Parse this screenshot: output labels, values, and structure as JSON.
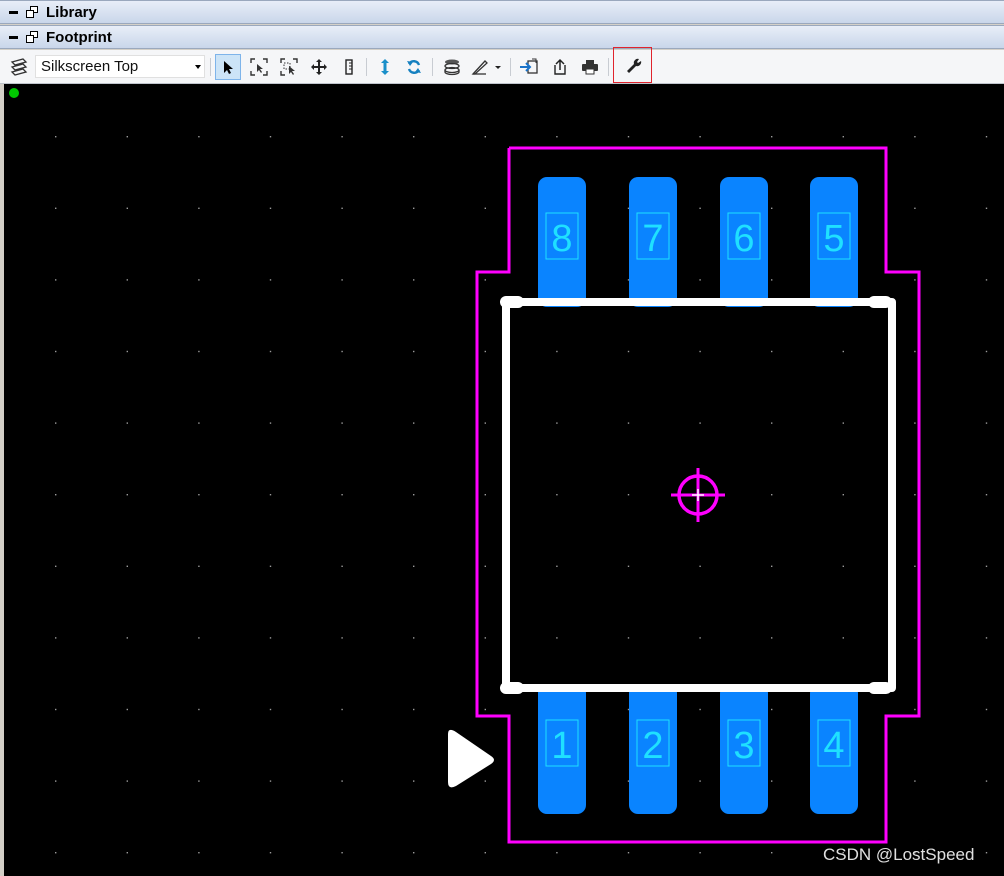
{
  "panels": {
    "library_title": "Library",
    "footprint_title": "Footprint"
  },
  "toolbar": {
    "layer_value": "Silkscreen Top",
    "icons": [
      "layers-icon",
      "select-arrow-icon",
      "zoom-fit-icon",
      "zoom-area-icon",
      "move-icon",
      "measure-icon",
      "flip-icon",
      "rotate-icon",
      "layer-stack-icon",
      "draw-tool-icon",
      "import-icon",
      "export-icon",
      "print-icon",
      "wrench-icon"
    ]
  },
  "canvas": {
    "background": "#000000",
    "grid_dot_color": "#9a9a9a",
    "courtyard_color": "#ff00ff",
    "pad_color": "#0a84ff",
    "pad_number_color": "#1fe0ff",
    "silkscreen_color": "#ffffff",
    "assembly_color": "#ffcc00",
    "origin_dot_color": "#00c800",
    "top_pads": [
      "8",
      "7",
      "6",
      "5"
    ],
    "bottom_pads": [
      "1",
      "2",
      "3",
      "4"
    ]
  },
  "watermark": "CSDN @LostSpeed"
}
